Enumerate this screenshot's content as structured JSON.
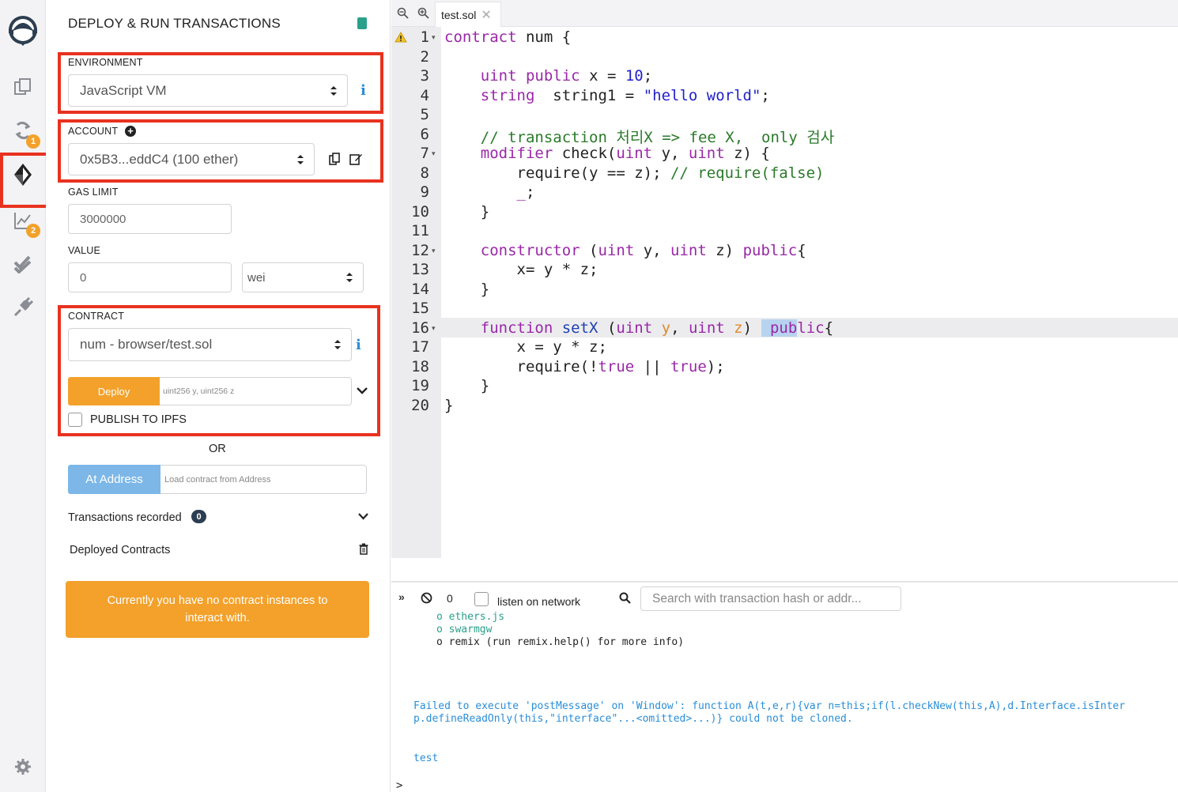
{
  "panel": {
    "title": "DEPLOY & RUN TRANSACTIONS",
    "environment": {
      "label": "ENVIRONMENT",
      "value": "JavaScript VM"
    },
    "account": {
      "label": "ACCOUNT",
      "value": "0x5B3...eddC4 (100 ether)"
    },
    "gas_limit": {
      "label": "GAS LIMIT",
      "value": "3000000"
    },
    "value": {
      "label": "VALUE",
      "amount": "0",
      "unit": "wei"
    },
    "contract": {
      "label": "CONTRACT",
      "value": "num - browser/test.sol"
    },
    "deploy": {
      "label": "Deploy",
      "placeholder": "uint256 y, uint256 z"
    },
    "publish_label": "PUBLISH TO IPFS",
    "or_label": "OR",
    "at_address": {
      "label": "At Address",
      "placeholder": "Load contract from Address"
    },
    "transactions_recorded": {
      "label": "Transactions recorded",
      "count": "0"
    },
    "deployed_contracts_label": "Deployed Contracts",
    "notice_line1": "Currently you have no contract instances to",
    "notice_line2": "interact with."
  },
  "sidebar": {
    "badges": {
      "compile": "1",
      "analysis": "2"
    },
    "active_item": "deploy-run"
  },
  "editor": {
    "tab_name": "test.sol",
    "line_numbers": [
      "1",
      "2",
      "3",
      "4",
      "5",
      "6",
      "7",
      "8",
      "9",
      "10",
      "11",
      "12",
      "13",
      "14",
      "15",
      "16",
      "17",
      "18",
      "19",
      "20"
    ]
  },
  "terminal": {
    "count": "0",
    "listen_label": "listen on network",
    "search_placeholder": "Search with transaction hash or addr...",
    "lines": {
      "ethers": "o ethers.js",
      "swarmgw": "o swarmgw",
      "remix": "o remix (run remix.help() for more info)",
      "error1": "Failed to execute 'postMessage' on 'Window': function A(t,e,r){var n=this;if(l.checkNew(this,A),d.Interface.isInter",
      "error2": "p.defineReadOnly(this,\"interface\"...<omitted>...)} could not be cloned.",
      "test": "test",
      "prompt": ">"
    }
  },
  "colors": {
    "accent_orange": "#f3a12b",
    "highlight_red": "#e8321f",
    "button_blue": "#7cb7e8"
  }
}
